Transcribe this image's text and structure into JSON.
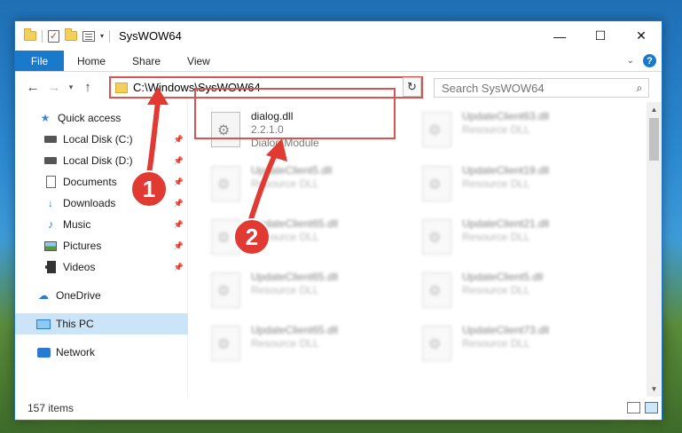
{
  "window": {
    "title": "SysWOW64",
    "controls": {
      "minimize": "—",
      "maximize": "☐",
      "close": "✕"
    }
  },
  "ribbon": {
    "tabs": [
      "File",
      "Home",
      "Share",
      "View"
    ]
  },
  "address": {
    "path": "C:\\Windows\\SysWOW64",
    "search_placeholder": "Search SysWOW64"
  },
  "sidebar": {
    "items": [
      {
        "label": "Quick access",
        "icon": "star-icon",
        "pinned": false
      },
      {
        "label": "Local Disk (C:)",
        "icon": "disk-icon",
        "pinned": true
      },
      {
        "label": "Local Disk (D:)",
        "icon": "disk-icon",
        "pinned": true
      },
      {
        "label": "Documents",
        "icon": "documents-icon",
        "pinned": true
      },
      {
        "label": "Downloads",
        "icon": "downloads-icon",
        "pinned": true
      },
      {
        "label": "Music",
        "icon": "music-icon",
        "pinned": true
      },
      {
        "label": "Pictures",
        "icon": "pictures-icon",
        "pinned": true
      },
      {
        "label": "Videos",
        "icon": "videos-icon",
        "pinned": true
      },
      {
        "label": "OneDrive",
        "icon": "onedrive-icon",
        "pinned": false
      },
      {
        "label": "This PC",
        "icon": "this-pc-icon",
        "selected": true
      },
      {
        "label": "Network",
        "icon": "network-icon",
        "pinned": false
      }
    ]
  },
  "files": {
    "highlighted": {
      "name": "dialog.dll",
      "version": "2.2.1.0",
      "description": "Dialog Module"
    },
    "col2": [
      {
        "name": "UpdateClient63.dll",
        "description": "Resource DLL"
      },
      {
        "name": "UpdateClient19.dll",
        "description": "Resource DLL"
      },
      {
        "name": "UpdateClient21.dll",
        "description": "Resource DLL"
      },
      {
        "name": "UpdateClient5.dll",
        "description": "Resource DLL"
      },
      {
        "name": "UpdateClient73.dll",
        "description": "Resource DLL"
      }
    ],
    "col1": [
      {
        "name": "UpdateClient5.dll",
        "description": "Resource DLL"
      },
      {
        "name": "UpdateClient65.dll",
        "description": "Resource DLL"
      },
      {
        "name": "UpdateClient65.dll",
        "description": "Resource DLL"
      },
      {
        "name": "UpdateClient65.dll",
        "description": "Resource DLL"
      }
    ]
  },
  "status": {
    "item_count": "157 items"
  },
  "callouts": [
    "1",
    "2"
  ],
  "colors": {
    "accent": "#1979ca",
    "highlight": "#d9534f",
    "callout": "#e03a32"
  }
}
